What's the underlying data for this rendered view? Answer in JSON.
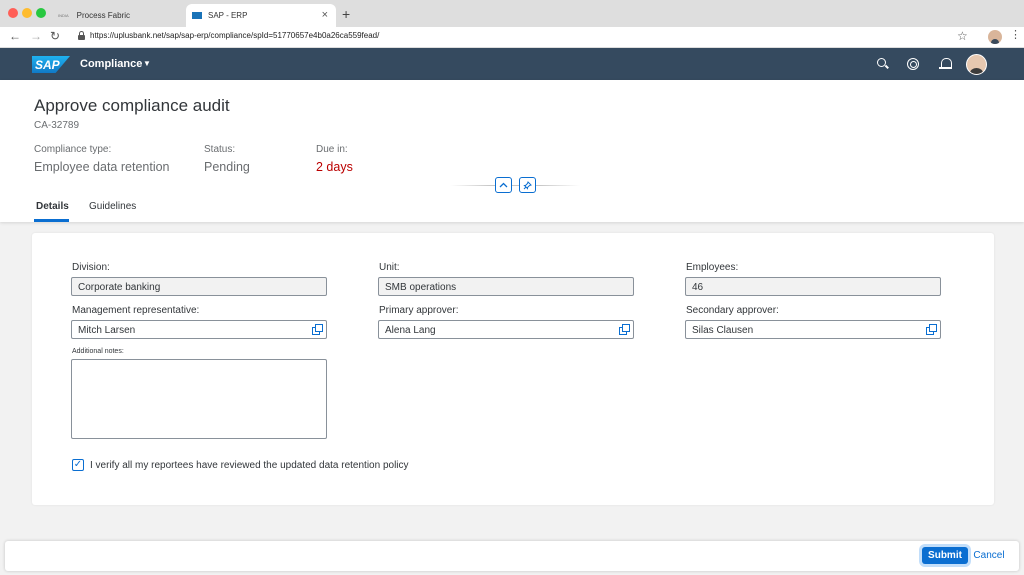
{
  "browser": {
    "tabs": [
      {
        "label": "Process Fabric",
        "favicon_text": "INDIA"
      },
      {
        "label": "SAP - ERP"
      }
    ],
    "url": "https://uplusbank.net/sap/sap-erp/compliance/spId=51770657e4b0a26ca559fead/"
  },
  "shell": {
    "logo": "SAP",
    "title": "Compliance"
  },
  "header": {
    "title": "Approve compliance audit",
    "id": "CA-32789",
    "attributes": [
      {
        "label": "Compliance type:",
        "value": "Employee data retention"
      },
      {
        "label": "Status:",
        "value": "Pending"
      },
      {
        "label": "Due in:",
        "value": "2 days"
      }
    ],
    "tabs": [
      "Details",
      "Guidelines"
    ]
  },
  "form": {
    "division": {
      "label": "Division:",
      "value": "Corporate banking"
    },
    "unit": {
      "label": "Unit:",
      "value": "SMB operations"
    },
    "employees": {
      "label": "Employees:",
      "value": "46"
    },
    "management_rep": {
      "label": "Management representative:",
      "value": "Mitch Larsen"
    },
    "primary_approver": {
      "label": "Primary approver:",
      "value": "Alena Lang"
    },
    "secondary_approver": {
      "label": "Secondary approver:",
      "value": "Silas Clausen"
    },
    "notes": {
      "label": "Additional notes:",
      "value": ""
    },
    "verify": {
      "label": "I verify all my reportees have reviewed the updated data retention policy",
      "checked": true
    }
  },
  "footer": {
    "submit": "Submit",
    "cancel": "Cancel"
  },
  "colors": {
    "shell": "#354a5f",
    "accent": "#0a6ed1",
    "warning": "#bb0000"
  }
}
